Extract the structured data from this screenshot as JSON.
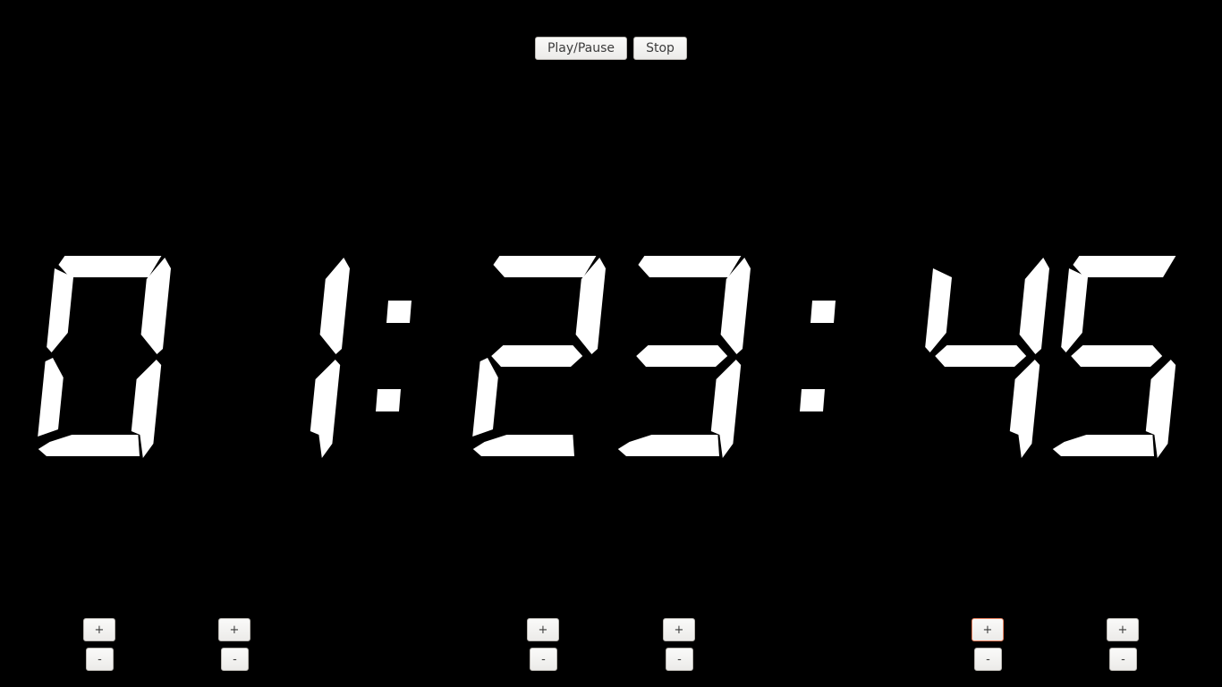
{
  "toolbar": {
    "play_pause_label": "Play/Pause",
    "stop_label": "Stop"
  },
  "display": {
    "time": "01:23:45",
    "digits": [
      "0",
      "1",
      "2",
      "3",
      "4",
      "5"
    ],
    "separator": ":",
    "segment_color": "#ffffff",
    "background_color": "#000000"
  },
  "adjusters": [
    {
      "digit": "hours-tens",
      "plus": "+",
      "minus": "-"
    },
    {
      "digit": "hours-ones",
      "plus": "+",
      "minus": "-"
    },
    {
      "digit": "minutes-tens",
      "plus": "+",
      "minus": "-"
    },
    {
      "digit": "minutes-ones",
      "plus": "+",
      "minus": "-"
    },
    {
      "digit": "seconds-tens",
      "plus": "+",
      "minus": "-",
      "focused": true
    },
    {
      "digit": "seconds-ones",
      "plus": "+",
      "minus": "-"
    }
  ]
}
